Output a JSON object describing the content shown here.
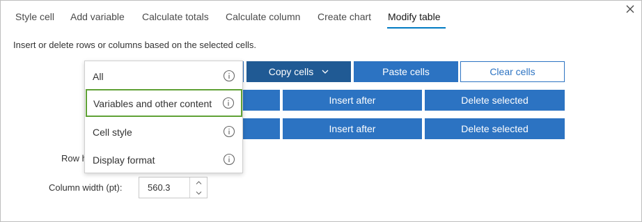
{
  "tabs": [
    {
      "label": "Style cell"
    },
    {
      "label": "Add variable"
    },
    {
      "label": "Calculate totals"
    },
    {
      "label": "Calculate column"
    },
    {
      "label": "Create chart"
    },
    {
      "label": "Modify table",
      "active": true
    }
  ],
  "description": "Insert or delete rows or columns based on the selected cells.",
  "toolbar": {
    "copy_cells_label": "Copy cells",
    "paste_cells_label": "Paste cells",
    "clear_cells_label": "Clear cells"
  },
  "rows_row": {
    "insert_after_label": "Insert after",
    "delete_selected_label": "Delete selected"
  },
  "columns_row": {
    "insert_after_label": "Insert after",
    "delete_selected_label": "Delete selected"
  },
  "row_height": {
    "label_partial": "Row h"
  },
  "column_width": {
    "label": "Column width (pt):",
    "value": "560.3"
  },
  "copy_menu": {
    "items": [
      {
        "label": "All",
        "icon": "info-icon"
      },
      {
        "label": "Variables and other content",
        "icon": "info-icon",
        "selected": true
      },
      {
        "label": "Cell style",
        "icon": "info-icon"
      },
      {
        "label": "Display format",
        "icon": "info-icon"
      }
    ]
  },
  "colors": {
    "primary": "#2c73c2",
    "primary_active": "#205a94",
    "tab_underline": "#007ac2",
    "selected_outline": "#5fa135"
  }
}
